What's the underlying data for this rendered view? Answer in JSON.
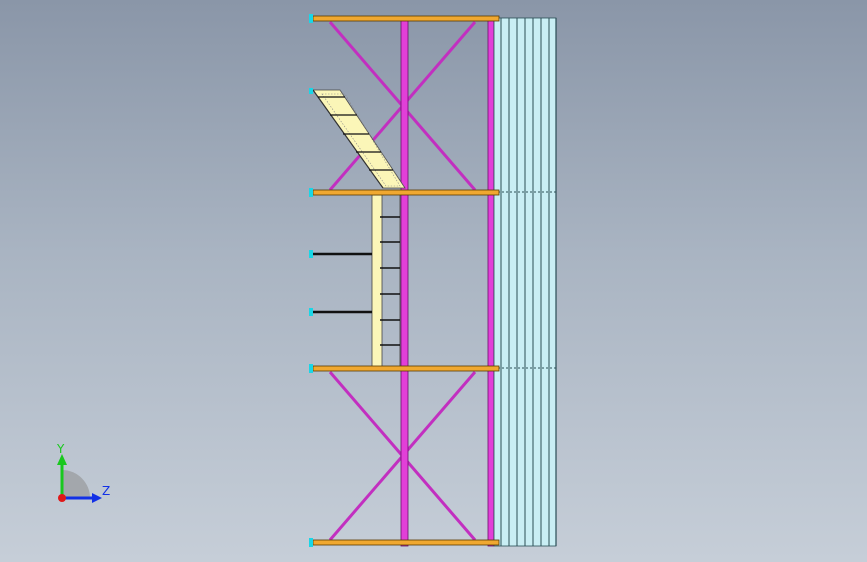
{
  "view": {
    "background_top": "#8a96a8",
    "background_bottom": "#c6ced8"
  },
  "colors": {
    "beam": "#f0a830",
    "beam_outline": "#5a3a00",
    "column": "#e23fd8",
    "bracing": "#c22fc0",
    "ladder_rail": "#fbf6b8",
    "cladding": "#a8e3ee",
    "endpoint": "#19d6e6"
  },
  "triad": {
    "y_label": "Y",
    "z_label": "Z",
    "y_color": "#19c81e",
    "z_color": "#1230e6",
    "origin_color": "#e01818"
  }
}
